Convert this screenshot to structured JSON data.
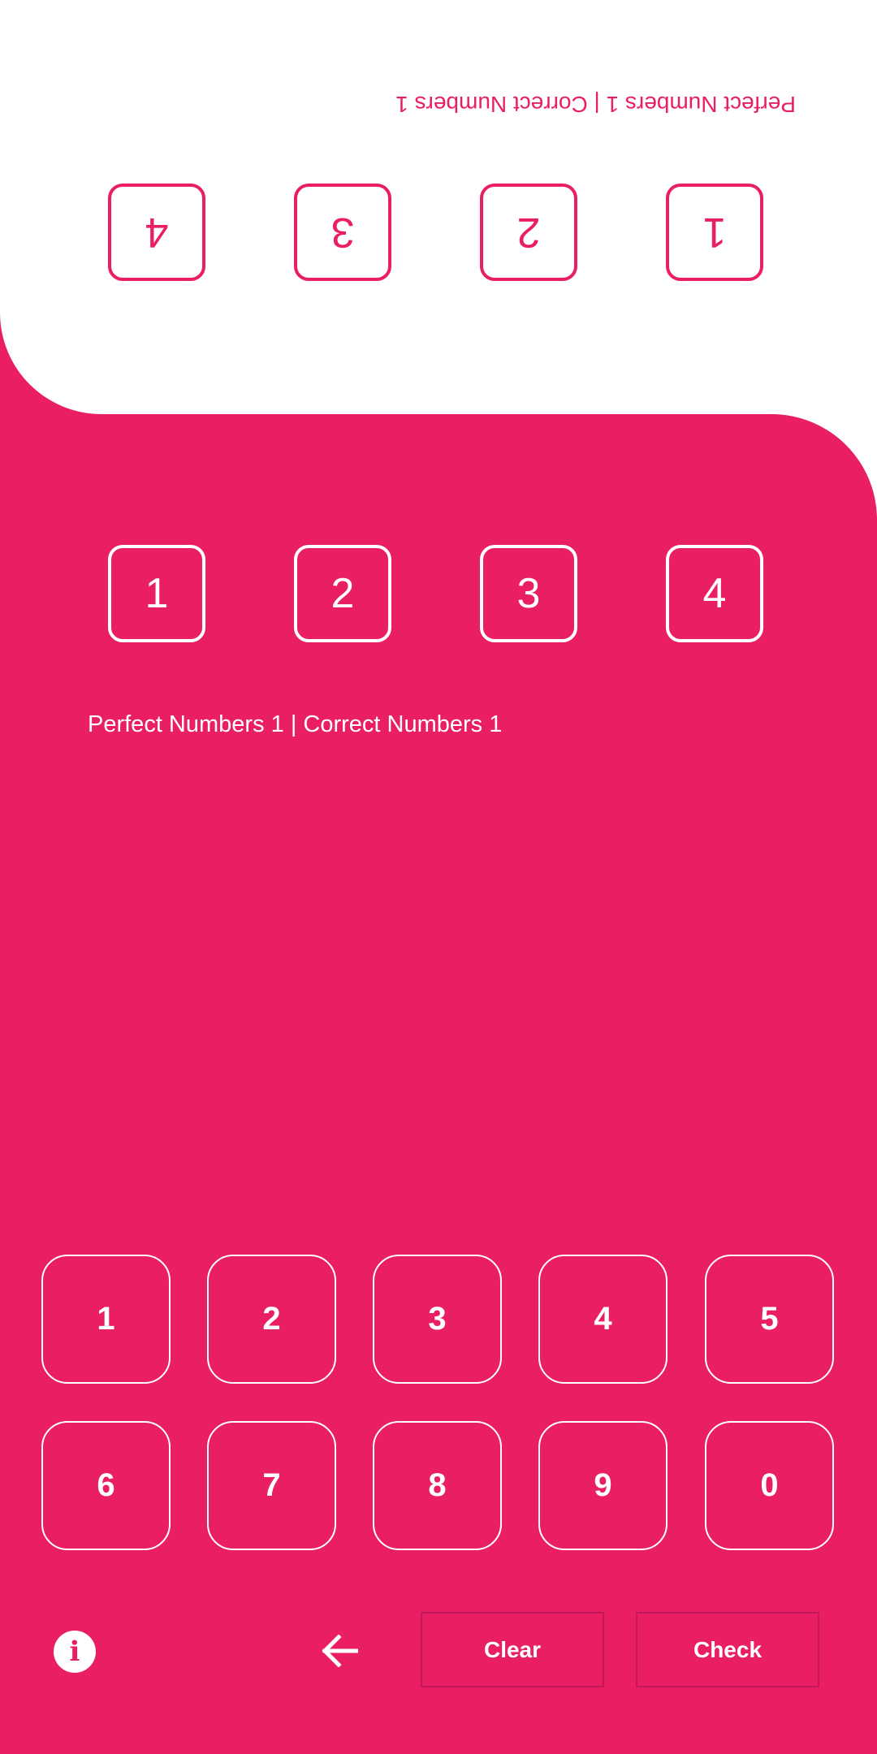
{
  "colors": {
    "accent": "#e91e63",
    "surface": "#ffffff"
  },
  "opponent": {
    "status": "Perfect Numbers 1 | Correct Numbers 1",
    "digits": [
      "1",
      "2",
      "3",
      "4"
    ]
  },
  "player": {
    "digits": [
      "1",
      "2",
      "3",
      "4"
    ],
    "status": "Perfect Numbers 1 | Correct Numbers 1"
  },
  "keypad": {
    "keys": [
      "1",
      "2",
      "3",
      "4",
      "5",
      "6",
      "7",
      "8",
      "9",
      "0"
    ]
  },
  "controls": {
    "info_icon": "info-icon",
    "back_icon": "arrow-left-icon",
    "clear_label": "Clear",
    "check_label": "Check"
  }
}
